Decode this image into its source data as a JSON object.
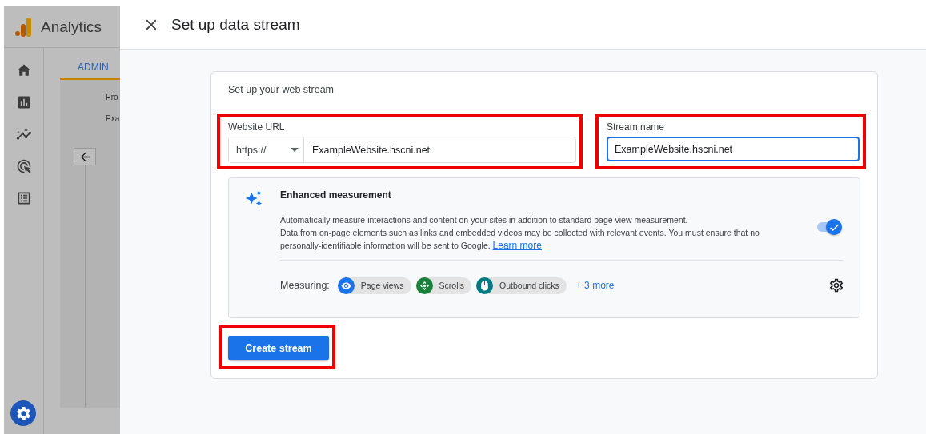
{
  "app": {
    "name": "Analytics",
    "tab": "ADMIN",
    "fragments": [
      "Pro",
      "Exa"
    ]
  },
  "dialog": {
    "title": "Set up data stream",
    "card_title": "Set up your web stream",
    "url": {
      "label": "Website URL",
      "protocol": "https://",
      "value": "ExampleWebsite.hscni.net",
      "highlighted": true
    },
    "stream_name": {
      "label": "Stream name",
      "value": "ExampleWebsite.hscni.net",
      "focused": true,
      "highlighted": true
    },
    "enhanced": {
      "title": "Enhanced measurement",
      "description": "Automatically measure interactions and content on your sites in addition to standard page view measurement.",
      "note": "Data from on-page elements such as links and embedded videos may be collected with relevant events. You must ensure that no personally-identifiable information will be sent to Google.",
      "link": "Learn more",
      "on": true,
      "measuring_label": "Measuring:",
      "chips": [
        {
          "kind": "eye",
          "label": "Page views",
          "color": "#1a73e8"
        },
        {
          "kind": "scroll",
          "label": "Scrolls",
          "color": "#188038"
        },
        {
          "kind": "mouse",
          "label": "Outbound clicks",
          "color": "#007b83"
        }
      ],
      "more": "+ 3 more"
    },
    "create_button": {
      "label": "Create stream",
      "highlighted": true
    }
  }
}
